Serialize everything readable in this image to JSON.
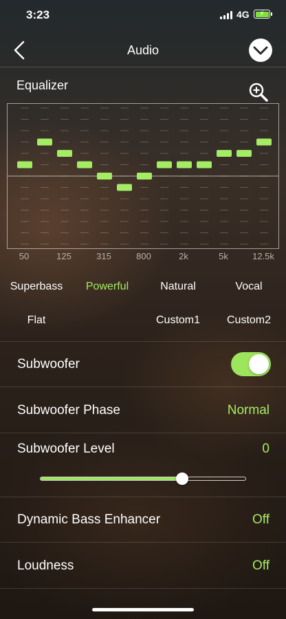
{
  "status_bar": {
    "time": "3:23",
    "network": "4G",
    "battery_color": "#7fe03a"
  },
  "header": {
    "title": "Audio",
    "back_icon": "chevron-left-icon",
    "confirm_icon": "chevron-down-circle-icon"
  },
  "equalizer": {
    "title": "Equalizer",
    "zoom_icon": "zoom-in-icon",
    "accent_color": "#a4ec63",
    "bands": [
      {
        "label": "50",
        "level": 1
      },
      {
        "label": "",
        "level": 3
      },
      {
        "label": "125",
        "level": 2
      },
      {
        "label": "",
        "level": 1
      },
      {
        "label": "315",
        "level": 0
      },
      {
        "label": "",
        "level": -1
      },
      {
        "label": "800",
        "level": 0
      },
      {
        "label": "",
        "level": 1
      },
      {
        "label": "2k",
        "level": 1
      },
      {
        "label": "",
        "level": 1
      },
      {
        "label": "5k",
        "level": 2
      },
      {
        "label": "",
        "level": 2
      },
      {
        "label": "12.5k",
        "level": 3
      }
    ],
    "level_range": [
      -6,
      6
    ]
  },
  "presets": {
    "row1": [
      "Superbass",
      "Powerful",
      "Natural",
      "Vocal"
    ],
    "row2": [
      "Flat",
      "",
      "Custom1",
      "Custom2"
    ],
    "active": "Powerful"
  },
  "settings": {
    "subwoofer": {
      "label": "Subwoofer",
      "enabled": true
    },
    "subwoofer_phase": {
      "label": "Subwoofer Phase",
      "value": "Normal"
    },
    "subwoofer_level": {
      "label": "Subwoofer Level",
      "value": "0",
      "slider_fraction": 0.69
    },
    "dynamic_bass": {
      "label": "Dynamic Bass Enhancer",
      "value": "Off"
    },
    "loudness": {
      "label": "Loudness",
      "value": "Off"
    }
  }
}
